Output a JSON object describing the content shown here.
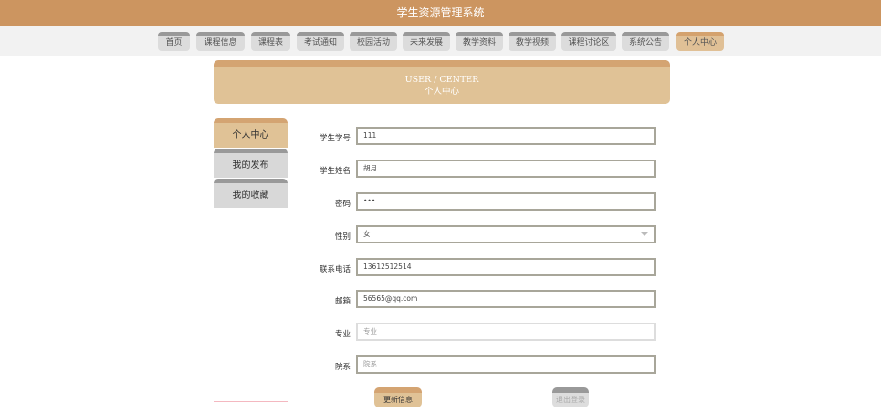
{
  "header": {
    "title": "学生资源管理系统"
  },
  "nav": [
    "首页",
    "课程信息",
    "课程表",
    "考试通知",
    "校园活动",
    "未来发展",
    "教学资料",
    "教学视频",
    "课程讨论区",
    "系统公告",
    "个人中心"
  ],
  "banner": {
    "en": "USER / CENTER",
    "zh": "个人中心"
  },
  "sidebar": [
    "个人中心",
    "我的发布",
    "我的收藏"
  ],
  "form": {
    "student_id": {
      "label": "学生学号",
      "value": "111"
    },
    "name": {
      "label": "学生姓名",
      "value": "胡月"
    },
    "password": {
      "label": "密码",
      "value": "•••"
    },
    "gender": {
      "label": "性别",
      "value": "女"
    },
    "phone": {
      "label": "联系电话",
      "value": "13612512514"
    },
    "email": {
      "label": "邮箱",
      "value": "56565@qq.com"
    },
    "major": {
      "label": "专业",
      "placeholder": "专业"
    },
    "department": {
      "label": "院系",
      "placeholder": "院系"
    }
  },
  "buttons": {
    "update": "更新信息",
    "logout": "退出登录"
  }
}
